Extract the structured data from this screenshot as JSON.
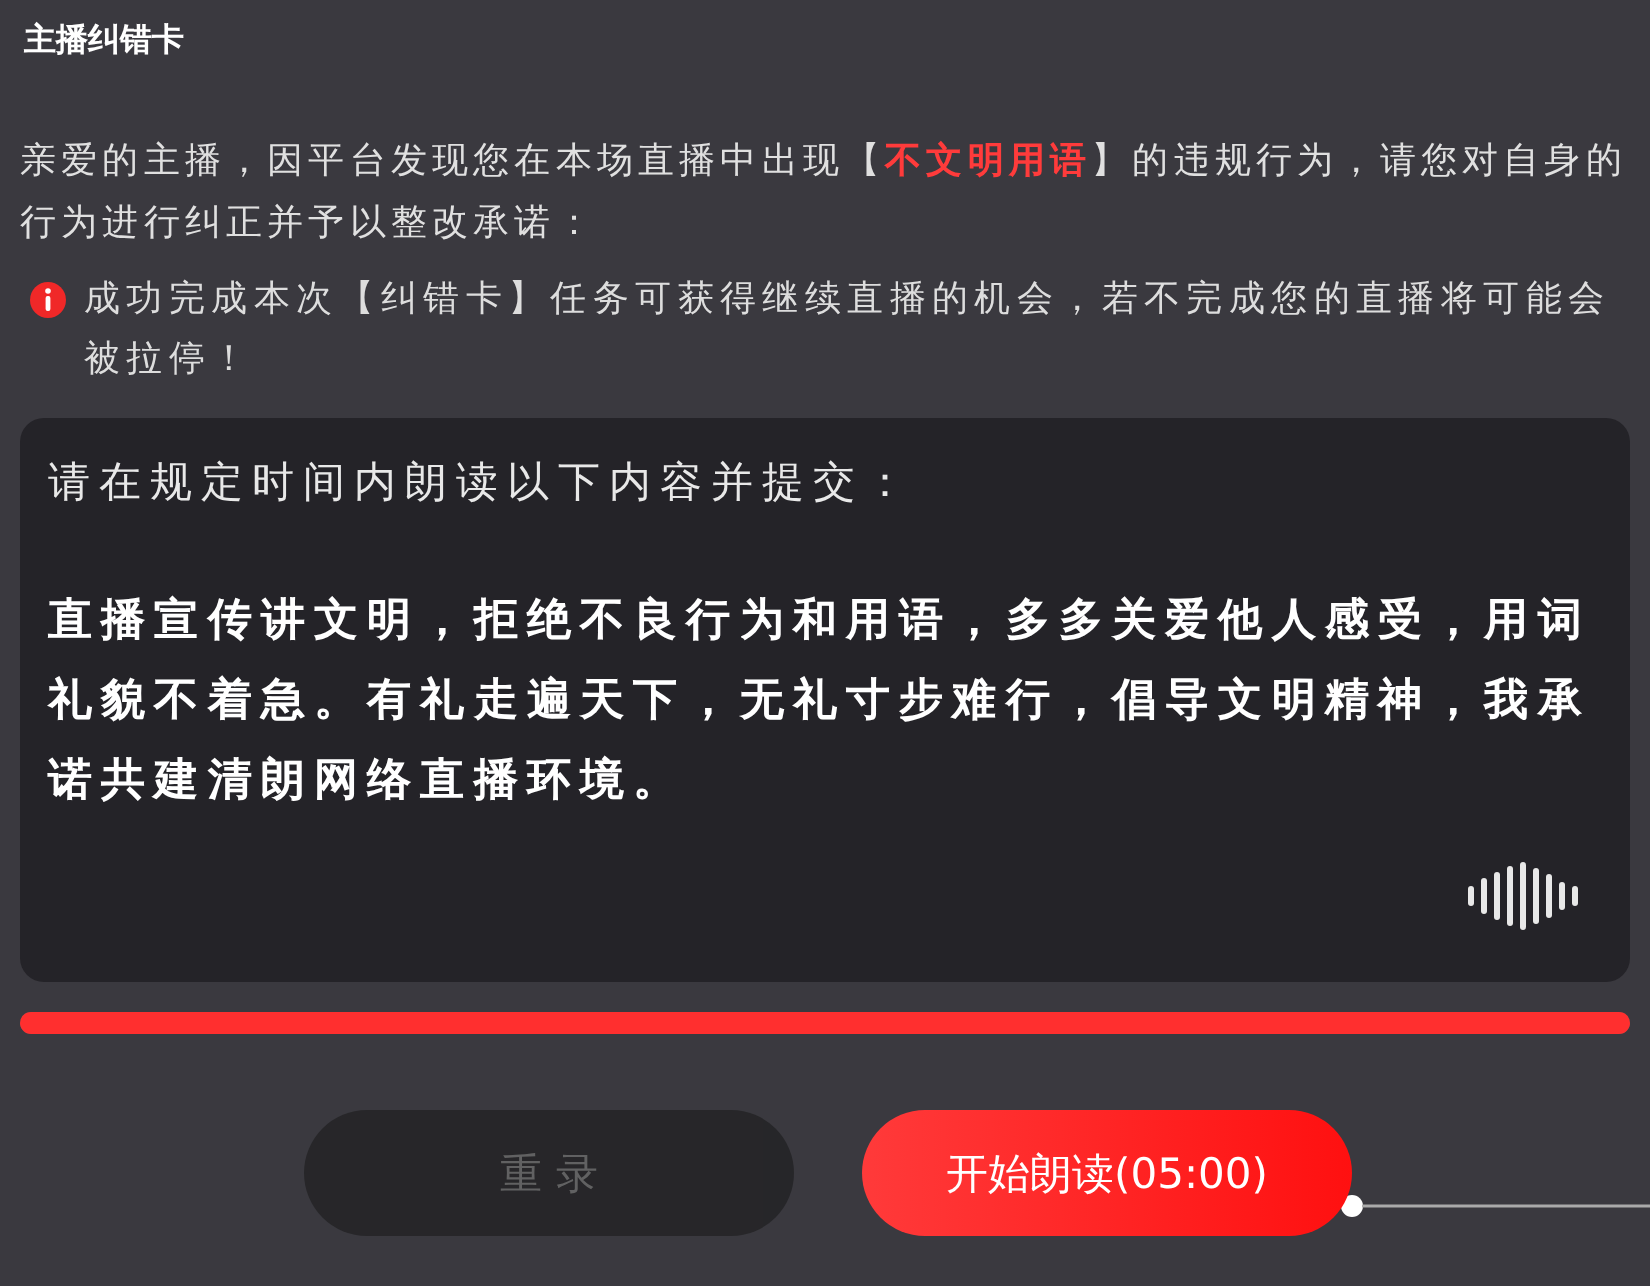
{
  "title": "主播纠错卡",
  "intro": {
    "before": "亲爱的主播，因平台发现您在本场直播中出现【",
    "highlight": "不文明用语",
    "after": "】的违规行为，请您对自身的行为进行纠正并予以整改承诺："
  },
  "notice": "成功完成本次【纠错卡】任务可获得继续直播的机会，若不完成您的直播将可能会被拉停！",
  "card": {
    "instruction": "请在规定时间内朗读以下内容并提交：",
    "passage": "直播宣传讲文明，拒绝不良行为和用语，多多关爱他人感受，用词礼貌不着急。有礼走遍天下，无礼寸步难行，倡导文明精神，我承诺共建清朗网络直播环境。"
  },
  "progress": {
    "level": 1
  },
  "buttons": [
    {
      "label": "重 录",
      "disabled": true
    },
    {
      "label": "开始朗读(05:00)",
      "disabled": false
    }
  ]
}
